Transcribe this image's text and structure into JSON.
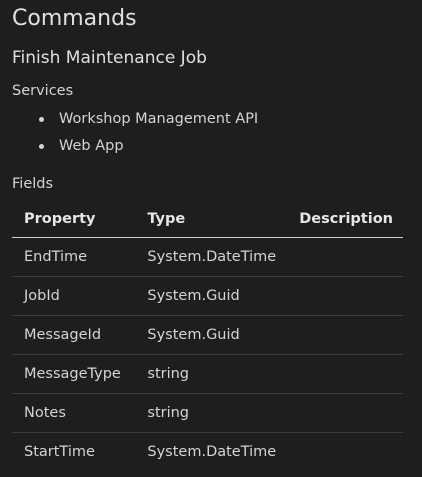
{
  "page": {
    "title": "Commands",
    "command_name": "Finish Maintenance Job",
    "services_heading": "Services",
    "services": [
      "Workshop Management API",
      "Web App"
    ],
    "fields_heading": "Fields"
  },
  "table": {
    "headers": [
      "Property",
      "Type",
      "Description"
    ],
    "rows": [
      {
        "property": "EndTime",
        "type": "System.DateTime",
        "description": ""
      },
      {
        "property": "JobId",
        "type": "System.Guid",
        "description": ""
      },
      {
        "property": "MessageId",
        "type": "System.Guid",
        "description": ""
      },
      {
        "property": "MessageType",
        "type": "string",
        "description": ""
      },
      {
        "property": "Notes",
        "type": "string",
        "description": ""
      },
      {
        "property": "StartTime",
        "type": "System.DateTime",
        "description": ""
      }
    ]
  },
  "colors": {
    "background": "#1e1e1e",
    "text": "#d4d4d4",
    "header_rule": "#cfcfcf",
    "row_rule": "#3c3c3c"
  }
}
